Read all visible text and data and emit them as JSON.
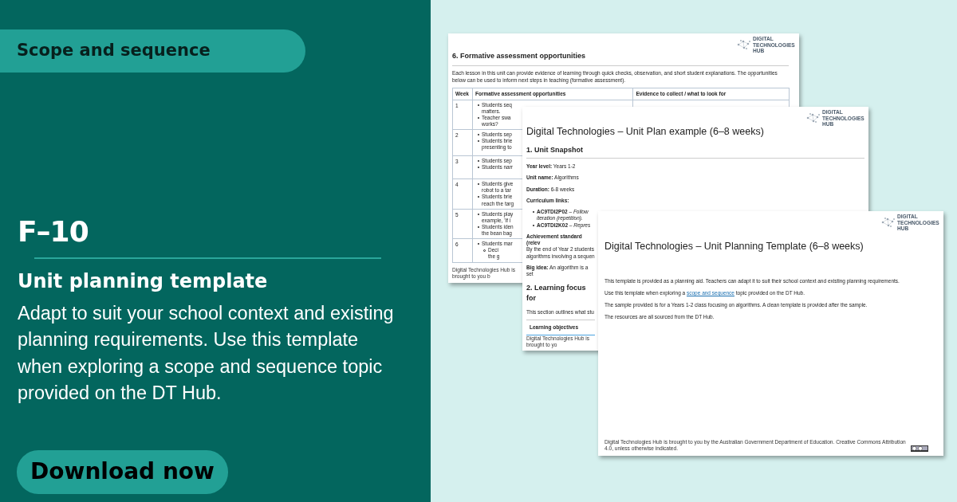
{
  "tag": "Scope and sequence",
  "grade": "F–10",
  "title": "Unit planning template",
  "description": "Adapt to suit your school context and existing planning requirements. Use this template when exploring a scope and sequence topic provided on the DT Hub.",
  "button": "Download now",
  "documents": [
    {
      "kind": "assessment",
      "logo": "DIGITAL TECHNOLOGIES HUB",
      "heading": "6. Formative assessment opportunities",
      "intro": "Each lesson in this unit can provide evidence of learning through quick checks, observation, and short student explanations. The opportunities below can be used to inform next steps in teaching (formative assessment).",
      "table": {
        "columns": [
          "Week",
          "Formative assessment opportunities",
          "Evidence to collect / what to look for"
        ],
        "rows": [
          {
            "week": "1",
            "items": [
              {
                "lines": [
                  "Students seq",
                  "matters."
                ]
              },
              {
                "lines": [
                  "Teacher swa",
                  "works?"
                ]
              }
            ]
          },
          {
            "week": "2",
            "items": [
              {
                "lines": [
                  "Students sep"
                ]
              },
              {
                "lines": [
                  "Students brie",
                  "presenting to"
                ]
              }
            ]
          },
          {
            "week": "3",
            "items": [
              {
                "lines": [
                  "Students sep"
                ]
              },
              {
                "lines": [
                  "Students narr"
                ]
              }
            ]
          },
          {
            "week": "4",
            "items": [
              {
                "lines": [
                  "Students give",
                  "robot to a tar"
                ]
              },
              {
                "lines": [
                  "Students brie",
                  "reach the targ"
                ]
              }
            ]
          },
          {
            "week": "5",
            "items": [
              {
                "lines": [
                  "Students play",
                  "example, 'If i"
                ]
              },
              {
                "lines": [
                  "Students iden",
                  "the bean bag"
                ]
              }
            ]
          },
          {
            "week": "6",
            "items": [
              {
                "lines": [
                  "Students mar"
                ],
                "children": [
                  {
                    "lines": [
                      "Deci",
                      "the g"
                    ]
                  }
                ]
              }
            ]
          }
        ]
      },
      "footer": "Digital Technologies Hub is brought to you b"
    },
    {
      "kind": "plan",
      "logo": "DIGITAL TECHNOLOGIES HUB",
      "title": "Digital Technologies – Unit Plan example (6–8 weeks)",
      "heading": "1. Unit Snapshot",
      "fields": [
        "**Year level:** Years 1-2",
        "**Unit name:** Algorithms",
        "**Duration:** 6-8 weeks",
        "**Curriculum links:**"
      ],
      "links": [
        {
          "lines": [
            "**AC9TDI2P02** – *Follow*",
            "*iteration (repetition).*"
          ]
        },
        {
          "lines": [
            "**AC9TDI2K02** – *Repres*"
          ]
        }
      ],
      "standard": {
        "label": "Achievement standard (relev",
        "lines": [
          "By the end of Year 2 students",
          "algorithms involving a sequen"
        ]
      },
      "big_idea": "**Big idea:** An algorithm is a set",
      "heading_2": "2. Learning focus for",
      "section_intro": "This section outlines what stu",
      "table_header": "Learning objectives",
      "footer": "Digital Technologies Hub is brought to yo"
    },
    {
      "kind": "template",
      "logo": "DIGITAL TECHNOLOGIES HUB",
      "title": "Digital Technologies – Unit Planning Template (6–8 weeks)",
      "paragraphs": [
        {
          "text": "This template is provided as a planning aid. Teachers can adapt it to suit their school context and existing planning requirements."
        },
        {
          "before": "Use this template when exploring a ",
          "link": "scope and sequence",
          "after": " topic provided on the DT Hub."
        },
        {
          "text": "The sample provided is for a Years 1-2 class focusing on algorithms. A clean template is provided after the sample."
        },
        {
          "text": "The resources are all sourced from the DT Hub."
        }
      ],
      "footer": "Digital Technologies Hub is brought to you by the Australian Government Department of Education. Creative Commons Attribution 4.0, unless otherwise indicated."
    }
  ]
}
